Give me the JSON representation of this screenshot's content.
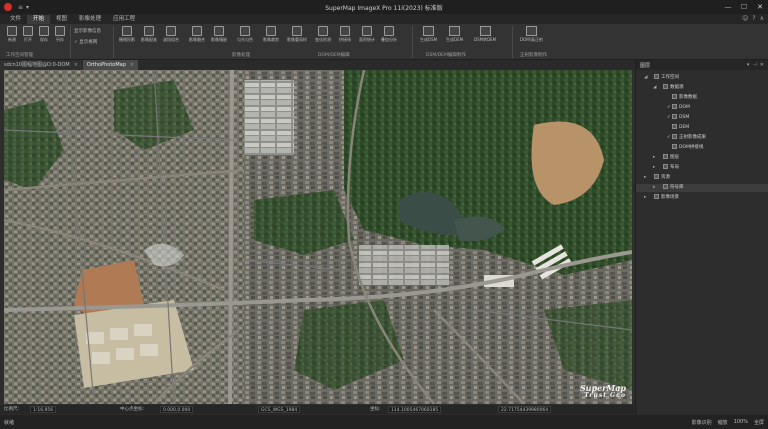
{
  "window": {
    "title": "SuperMap ImageX Pro 11i(2023) 标准版",
    "minimize": "—",
    "maximize": "☐",
    "close": "✕"
  },
  "quick_access": [
    "≡",
    "▾"
  ],
  "menu": {
    "tabs": [
      {
        "label": "文件",
        "active": false
      },
      {
        "label": "开始",
        "active": true
      },
      {
        "label": "视图",
        "active": false
      },
      {
        "label": "影像处理",
        "active": false
      },
      {
        "label": "应用工程",
        "active": false
      }
    ],
    "right": [
      "☺",
      "?",
      "∧"
    ]
  },
  "ribbon": {
    "buttons": [
      {
        "label": "新建"
      },
      {
        "label": "打开"
      },
      {
        "label": "保存"
      },
      {
        "label": "另存"
      },
      {
        "label": "栅格投影"
      },
      {
        "label": "影像配准"
      },
      {
        "label": "波段组合"
      },
      {
        "label": "影像融合"
      },
      {
        "label": "影像镶嵌"
      },
      {
        "label": "匀光匀色"
      },
      {
        "label": "影像裁剪"
      },
      {
        "label": "影像重采样"
      },
      {
        "label": "变化检测"
      },
      {
        "label": "拼接线"
      },
      {
        "label": "面积统计"
      },
      {
        "label": "叠加分析"
      }
    ],
    "dsm_buttons": [
      {
        "label": "生成DSM"
      },
      {
        "label": "生成DEM"
      },
      {
        "label": "DSM转DEM"
      }
    ],
    "last_button": {
      "label": "DOM/真正射"
    },
    "checks": [
      {
        "label": "显示影像信息"
      },
      {
        "label": "✓ 显示格网"
      }
    ],
    "groups": [
      "工作空间管理",
      "影像处理",
      "DOM/DEM编辑",
      "DSM/DEM编辑制作",
      "正射影像制作"
    ]
  },
  "doc_tabs": [
    {
      "label": "sdcn10图幅地图@D:0-DOM",
      "active": false,
      "close": "×"
    },
    {
      "label": "OrthoPhotoMap",
      "active": true,
      "close": "×"
    }
  ],
  "map": {
    "watermark_line1": "SuperMap",
    "watermark_line2": "Trust Geo"
  },
  "map_status": {
    "scale_label": "比例尺:",
    "scale_value": "1:16,956",
    "coord_label": "中心点坐标:",
    "coord_value": "0.000,0.000",
    "crs_value": "GCS_WGS_1984",
    "lng_label": "坐标:",
    "lng_value": "114.1005467060185",
    "lat_value": "22.71754439980064"
  },
  "panel": {
    "title": "图层",
    "ctrls": [
      "▾",
      "⊣",
      "✕"
    ],
    "tree": [
      {
        "level": 0,
        "arrow": "◢",
        "icon": true,
        "label": "工作空间",
        "tick": ""
      },
      {
        "level": 1,
        "arrow": "◢",
        "icon": true,
        "label": "数据源",
        "tick": ""
      },
      {
        "level": 2,
        "arrow": "",
        "icon": true,
        "label": "影像数据",
        "tick": ""
      },
      {
        "level": 2,
        "arrow": "",
        "icon": true,
        "label": "DOM",
        "tick": "✓"
      },
      {
        "level": 2,
        "arrow": "",
        "icon": true,
        "label": "DSM",
        "tick": "✓"
      },
      {
        "level": 2,
        "arrow": "",
        "icon": true,
        "label": "DEM",
        "tick": ""
      },
      {
        "level": 2,
        "arrow": "",
        "icon": true,
        "label": "正射影像成果",
        "tick": "✓"
      },
      {
        "level": 2,
        "arrow": "",
        "icon": true,
        "label": "DOM拼接线",
        "tick": ""
      },
      {
        "level": 1,
        "arrow": "▸",
        "icon": true,
        "label": "图层",
        "tick": ""
      },
      {
        "level": 1,
        "arrow": "▸",
        "icon": true,
        "label": "布局",
        "tick": ""
      },
      {
        "level": 0,
        "arrow": "▸",
        "icon": true,
        "label": "资源",
        "tick": ""
      },
      {
        "level": 1,
        "arrow": "▸",
        "icon": true,
        "label": "符号库",
        "tick": "",
        "selected": true
      },
      {
        "level": 0,
        "arrow": "▸",
        "icon": true,
        "label": "影像场景",
        "tick": ""
      }
    ]
  },
  "status": {
    "left": "就绪",
    "right": [
      "影像识别",
      "缩放",
      "100%",
      "全屏"
    ]
  }
}
